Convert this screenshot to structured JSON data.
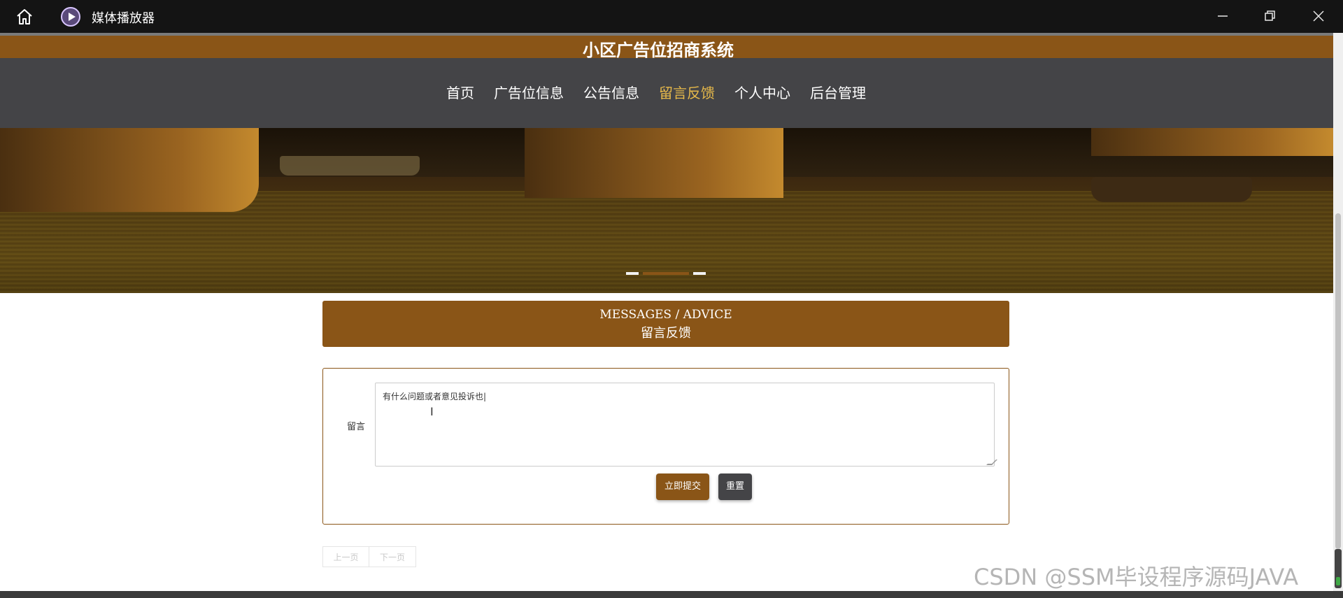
{
  "window": {
    "app_title": "媒体播放器"
  },
  "site": {
    "title": "小区广告位招商系统"
  },
  "nav": {
    "items": [
      {
        "label": "首页"
      },
      {
        "label": "广告位信息"
      },
      {
        "label": "公告信息"
      },
      {
        "label": "留言反馈",
        "active": true
      },
      {
        "label": "个人中心"
      },
      {
        "label": "后台管理"
      }
    ]
  },
  "section": {
    "title_en": "MESSAGES / ADVICE",
    "title_cn": "留言反馈"
  },
  "form": {
    "label": "留言",
    "textarea_value": "有什么问题或者意见投诉也|",
    "submit_label": "立即提交",
    "reset_label": "重置"
  },
  "pagination": {
    "prev_label": "上一页",
    "next_label": "下一页"
  },
  "watermark": "CSDN @SSM毕设程序源码JAVA",
  "colors": {
    "brand": "#8a5517",
    "nav_bg": "#444447",
    "nav_active": "#e7b94a"
  },
  "banner": {
    "slide_count": 3,
    "active_slide": 2
  }
}
